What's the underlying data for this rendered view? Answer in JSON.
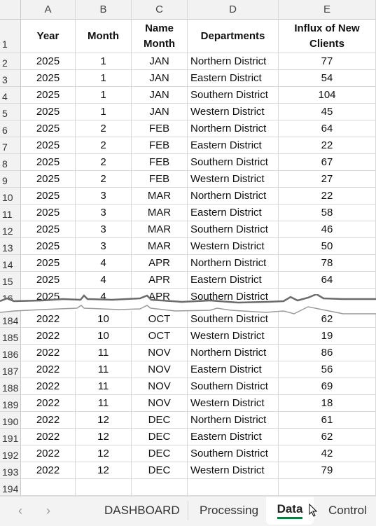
{
  "columns": [
    "A",
    "B",
    "C",
    "D",
    "E"
  ],
  "header": {
    "row": "1",
    "year": "Year",
    "month": "Month",
    "name_month": "Name Month",
    "departments": "Departments",
    "influx": "Influx of New Clients"
  },
  "rows_top": [
    [
      "2",
      "2025",
      "1",
      "JAN",
      "Northern District",
      "77"
    ],
    [
      "3",
      "2025",
      "1",
      "JAN",
      "Eastern District",
      "54"
    ],
    [
      "4",
      "2025",
      "1",
      "JAN",
      "Southern District",
      "104"
    ],
    [
      "5",
      "2025",
      "1",
      "JAN",
      "Western District",
      "45"
    ],
    [
      "6",
      "2025",
      "2",
      "FEB",
      "Northern District",
      "64"
    ],
    [
      "7",
      "2025",
      "2",
      "FEB",
      "Eastern District",
      "22"
    ],
    [
      "8",
      "2025",
      "2",
      "FEB",
      "Southern District",
      "67"
    ],
    [
      "9",
      "2025",
      "2",
      "FEB",
      "Western District",
      "27"
    ],
    [
      "10",
      "2025",
      "3",
      "MAR",
      "Northern District",
      "22"
    ],
    [
      "11",
      "2025",
      "3",
      "MAR",
      "Eastern District",
      "58"
    ],
    [
      "12",
      "2025",
      "3",
      "MAR",
      "Southern District",
      "46"
    ],
    [
      "13",
      "2025",
      "3",
      "MAR",
      "Western District",
      "50"
    ],
    [
      "14",
      "2025",
      "4",
      "APR",
      "Northern District",
      "78"
    ],
    [
      "15",
      "2025",
      "4",
      "APR",
      "Eastern District",
      "64"
    ],
    [
      "16",
      "2025",
      "4",
      "APR",
      "Southern District",
      ""
    ]
  ],
  "rows_bottom": [
    [
      "184",
      "2022",
      "10",
      "OCT",
      "Southern District",
      "62"
    ],
    [
      "185",
      "2022",
      "10",
      "OCT",
      "Western District",
      "19"
    ],
    [
      "186",
      "2022",
      "11",
      "NOV",
      "Northern District",
      "86"
    ],
    [
      "187",
      "2022",
      "11",
      "NOV",
      "Eastern District",
      "56"
    ],
    [
      "188",
      "2022",
      "11",
      "NOV",
      "Southern District",
      "69"
    ],
    [
      "189",
      "2022",
      "11",
      "NOV",
      "Western District",
      "18"
    ],
    [
      "190",
      "2022",
      "12",
      "DEC",
      "Northern District",
      "61"
    ],
    [
      "191",
      "2022",
      "12",
      "DEC",
      "Eastern District",
      "62"
    ],
    [
      "192",
      "2022",
      "12",
      "DEC",
      "Southern District",
      "42"
    ],
    [
      "193",
      "2022",
      "12",
      "DEC",
      "Western District",
      "79"
    ],
    [
      "194",
      "",
      "",
      "",
      "",
      ""
    ]
  ],
  "tabs": {
    "prev": "‹",
    "next": "›",
    "items": [
      "DASHBOARD",
      "Processing",
      "Data",
      "Control"
    ],
    "active": "Data",
    "accent": "#107c41"
  }
}
